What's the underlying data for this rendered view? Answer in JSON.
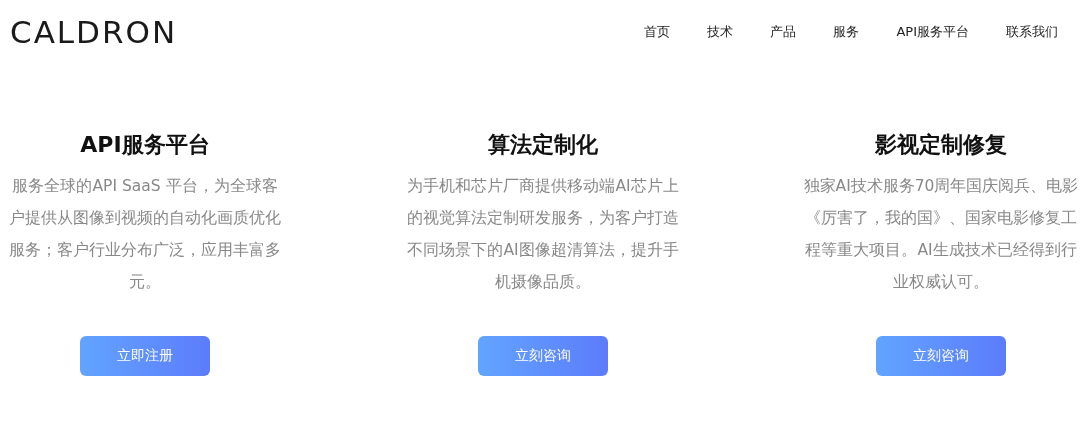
{
  "header": {
    "logo": "CALDRON",
    "nav": [
      {
        "label": "首页"
      },
      {
        "label": "技术"
      },
      {
        "label": "产品"
      },
      {
        "label": "服务"
      },
      {
        "label": "API服务平台"
      },
      {
        "label": "联系我们"
      }
    ]
  },
  "cards": [
    {
      "title": "API服务平台",
      "description": "服务全球的API SaaS 平台，为全球客户提供从图像到视频的自动化画质优化服务；客户行业分布广泛，应用丰富多元。",
      "button": "立即注册"
    },
    {
      "title": "算法定制化",
      "description": "为手机和芯片厂商提供移动端AI芯片上的视觉算法定制研发服务，为客户打造不同场景下的AI图像超清算法，提升手机摄像品质。",
      "button": "立刻咨询"
    },
    {
      "title": "影视定制修复",
      "description": "独家AI技术服务70周年国庆阅兵、电影《厉害了，我的国》、国家电影修复工程等重大项目。AI生成技术已经得到行业权威认可。",
      "button": "立刻咨询"
    }
  ]
}
